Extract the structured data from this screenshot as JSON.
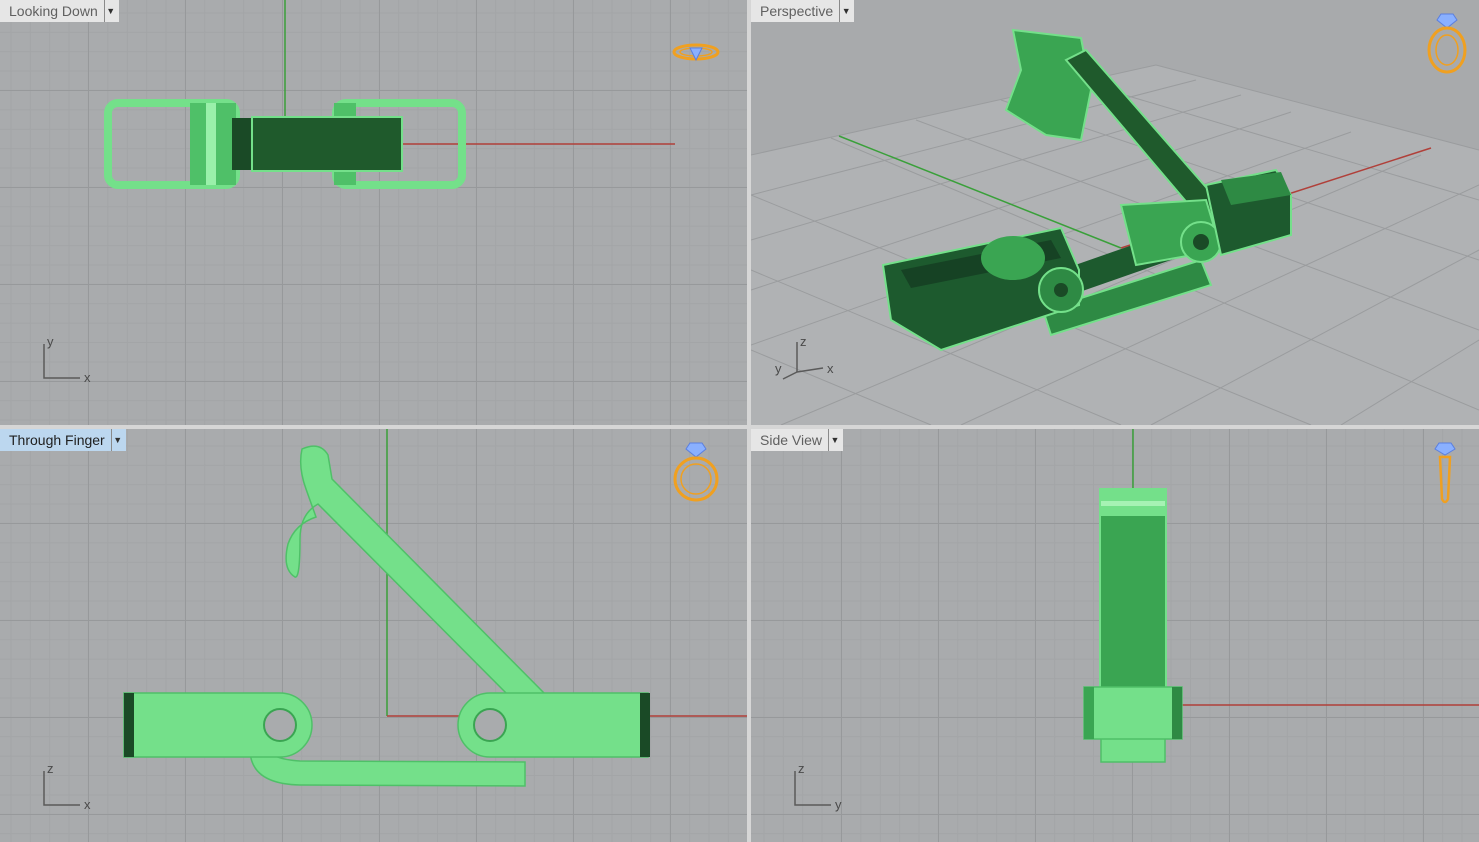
{
  "viewports": {
    "top": {
      "label": "Looking Down",
      "active": false
    },
    "persp": {
      "label": "Perspective",
      "active": false
    },
    "front": {
      "label": "Through Finger",
      "active": true
    },
    "side": {
      "label": "Side View",
      "active": false
    }
  },
  "axes": {
    "top": {
      "vertical": "y",
      "horizontal": "x"
    },
    "persp": {
      "vertical": "z",
      "left": "y",
      "right": "x"
    },
    "front": {
      "vertical": "z",
      "horizontal": "x"
    },
    "side": {
      "vertical": "z",
      "horizontal": "y"
    }
  },
  "icons": {
    "dropdown": "dropdown-arrow-icon",
    "nav": "ring-navigation-icon"
  },
  "colors": {
    "viewport_bg": "#a9abad",
    "grid_major": "#97999b",
    "grid_minor": "#a3a5a7",
    "x_axis": "#b0403a",
    "y_axis": "#3aa03a",
    "model_light": "#74e08a",
    "model_mid": "#3aa552",
    "model_dark": "#1a4a26",
    "active_label": "#bcd7ef",
    "nav_ring": "#f0a020",
    "nav_gem": "#5a7fe0"
  }
}
